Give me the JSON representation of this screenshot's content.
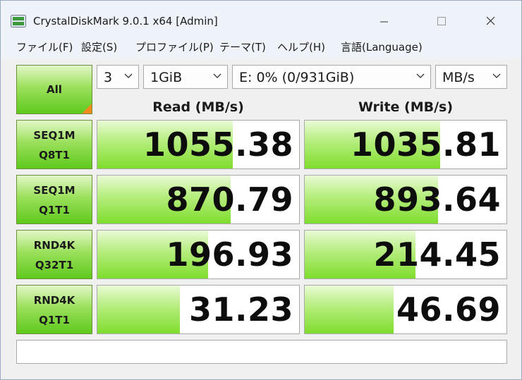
{
  "window": {
    "title": "CrystalDiskMark 9.0.1 x64 [Admin]"
  },
  "menu": [
    "ファイル(F)",
    "設定(S)",
    "プロファイル(P)",
    "テーマ(T)",
    "ヘルプ(H)",
    "言語(Language)"
  ],
  "controls": {
    "all_label": "All",
    "count": "3",
    "size": "1GiB",
    "drive": "E: 0% (0/931GiB)",
    "unit": "MB/s"
  },
  "headers": {
    "read": "Read (MB/s)",
    "write": "Write (MB/s)"
  },
  "tests": [
    {
      "line1": "SEQ1M",
      "line2": "Q8T1",
      "read": "1055.38",
      "write": "1035.81",
      "read_fill": 0.67,
      "write_fill": 0.67
    },
    {
      "line1": "SEQ1M",
      "line2": "Q1T1",
      "read": "870.79",
      "write": "893.64",
      "read_fill": 0.66,
      "write_fill": 0.66
    },
    {
      "line1": "RND4K",
      "line2": "Q32T1",
      "read": "196.93",
      "write": "214.45",
      "read_fill": 0.55,
      "write_fill": 0.55
    },
    {
      "line1": "RND4K",
      "line2": "Q1T1",
      "read": "31.23",
      "write": "46.69",
      "read_fill": 0.41,
      "write_fill": 0.44
    }
  ],
  "comment": "",
  "colors": {
    "bar_green": "#7fdd2c",
    "button_green": "#5fc91c",
    "corner_orange": "#f28a1e",
    "titlebar": "#eef3f9"
  },
  "icons": [
    "app-icon",
    "minimize-icon",
    "maximize-icon",
    "close-icon",
    "chevron-down-icon"
  ]
}
